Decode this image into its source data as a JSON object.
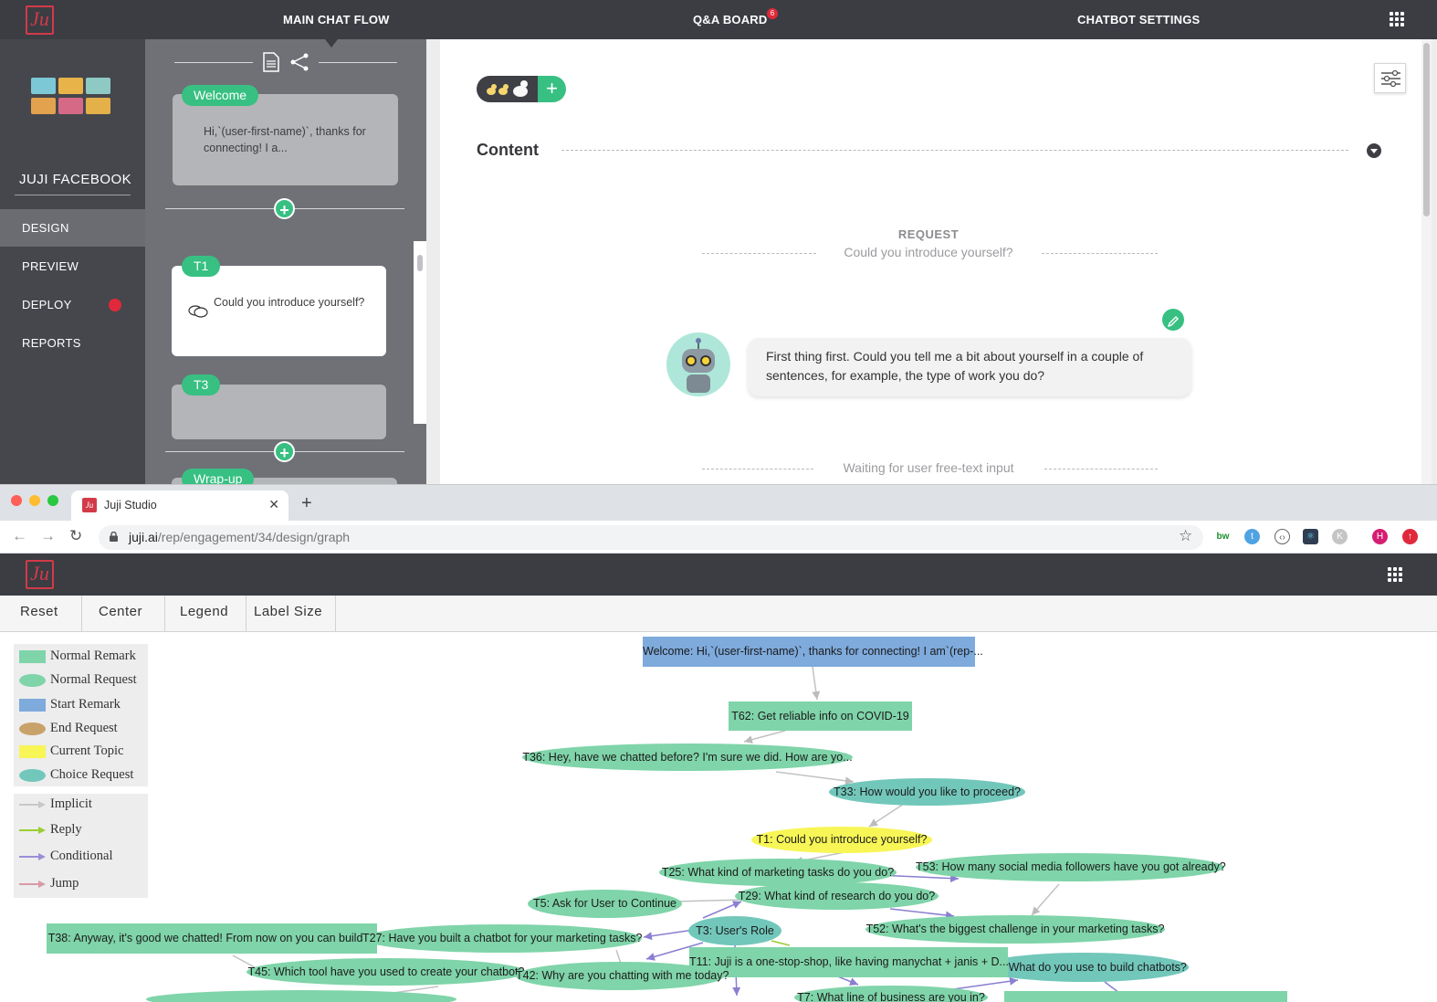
{
  "top_app": {
    "nav": {
      "main_chat_flow": "MAIN CHAT FLOW",
      "qa_board": "Q&A BOARD",
      "qa_badge": "6",
      "chatbot_settings": "CHATBOT SETTINGS"
    },
    "sidebar": {
      "team_name": "JUJI FACEBOOK",
      "items": [
        {
          "label": "DESIGN",
          "active": true
        },
        {
          "label": "PREVIEW"
        },
        {
          "label": "DEPLOY",
          "alert": true
        },
        {
          "label": "REPORTS"
        }
      ]
    },
    "flow": {
      "cards": [
        {
          "tag": "Welcome",
          "text": "Hi,`(user-first-name)`, thanks for connecting! I a..."
        },
        {
          "tag": "T1",
          "text": "Could you introduce yourself?"
        },
        {
          "tag": "T3",
          "text": ""
        },
        {
          "tag": "Wrap-up",
          "text": ""
        }
      ]
    },
    "content": {
      "title": "Content",
      "request_label": "REQUEST",
      "request_text": "Could you introduce yourself?",
      "bot_message": "First thing first. Could you tell me a bit about yourself in a couple of sentences, for example, the type of work you do?",
      "waiting_text": "Waiting for user free-text input"
    }
  },
  "browser": {
    "tab_title": "Juji Studio",
    "url_host": "juji.ai",
    "url_path": "/rep/engagement/34/design/graph",
    "extensions": [
      "bw",
      "twitter-icon",
      "code-icon",
      "react-icon",
      "k-icon",
      "H",
      "upload-icon"
    ]
  },
  "graph": {
    "toolbar": {
      "reset": "Reset",
      "center": "Center",
      "legend": "Legend",
      "label_size": "Label Size"
    },
    "legend_nodes": [
      {
        "label": "Normal Remark",
        "color": "#7fd4a9",
        "shape": "rect"
      },
      {
        "label": "Normal Request",
        "color": "#7fd4a9",
        "shape": "ellipse"
      },
      {
        "label": "Start Remark",
        "color": "#7eaadc",
        "shape": "rect"
      },
      {
        "label": "End Request",
        "color": "#c9a26b",
        "shape": "ellipse"
      },
      {
        "label": "Current Topic",
        "color": "#f7f656",
        "shape": "rect"
      },
      {
        "label": "Choice Request",
        "color": "#72c7bb",
        "shape": "ellipse"
      }
    ],
    "legend_edges": [
      {
        "label": "Implicit",
        "color": "#c8c8c8"
      },
      {
        "label": "Reply",
        "color": "#9acd32"
      },
      {
        "label": "Conditional",
        "color": "#9b8ed6"
      },
      {
        "label": "Jump",
        "color": "#d89aa8"
      }
    ],
    "nodes": [
      {
        "id": "welcome",
        "label": "Welcome: Hi,`(user-first-name)`, thanks for connecting! I am`(rep-..."
      },
      {
        "id": "t62",
        "label": "T62: Get reliable info on COVID-19"
      },
      {
        "id": "t36",
        "label": "T36: Hey, have we chatted before? I'm sure we did.  How are yo..."
      },
      {
        "id": "t33",
        "label": "T33: How would you like to proceed?"
      },
      {
        "id": "t1",
        "label": "T1: Could you introduce yourself?"
      },
      {
        "id": "t25",
        "label": "T25: What kind of marketing tasks do you do?"
      },
      {
        "id": "t53",
        "label": "T53: How many social media followers have you got already?"
      },
      {
        "id": "t29",
        "label": "T29: What kind of research do you do?"
      },
      {
        "id": "t5",
        "label": "T5: Ask for User to Continue"
      },
      {
        "id": "t52",
        "label": "T52: What's the biggest challenge in your marketing tasks?"
      },
      {
        "id": "t38",
        "label": "T38: Anyway,  it's good we chatted! From now on you can build ..."
      },
      {
        "id": "t27",
        "label": "T27: Have you built a chatbot for your marketing tasks?"
      },
      {
        "id": "t3",
        "label": "T3: User's Role"
      },
      {
        "id": "t11",
        "label": "T11: Juji is a one-stop-shop, like having manychat + janis + D..."
      },
      {
        "id": "t13",
        "label": "T13: What do you use to build chatbots?"
      },
      {
        "id": "t45",
        "label": "T45: Which tool have you used to create your chatbot?"
      },
      {
        "id": "t42",
        "label": "T42: Why are you chatting with me today?"
      },
      {
        "id": "t7",
        "label": "T7: What line of business are you in?"
      }
    ]
  }
}
